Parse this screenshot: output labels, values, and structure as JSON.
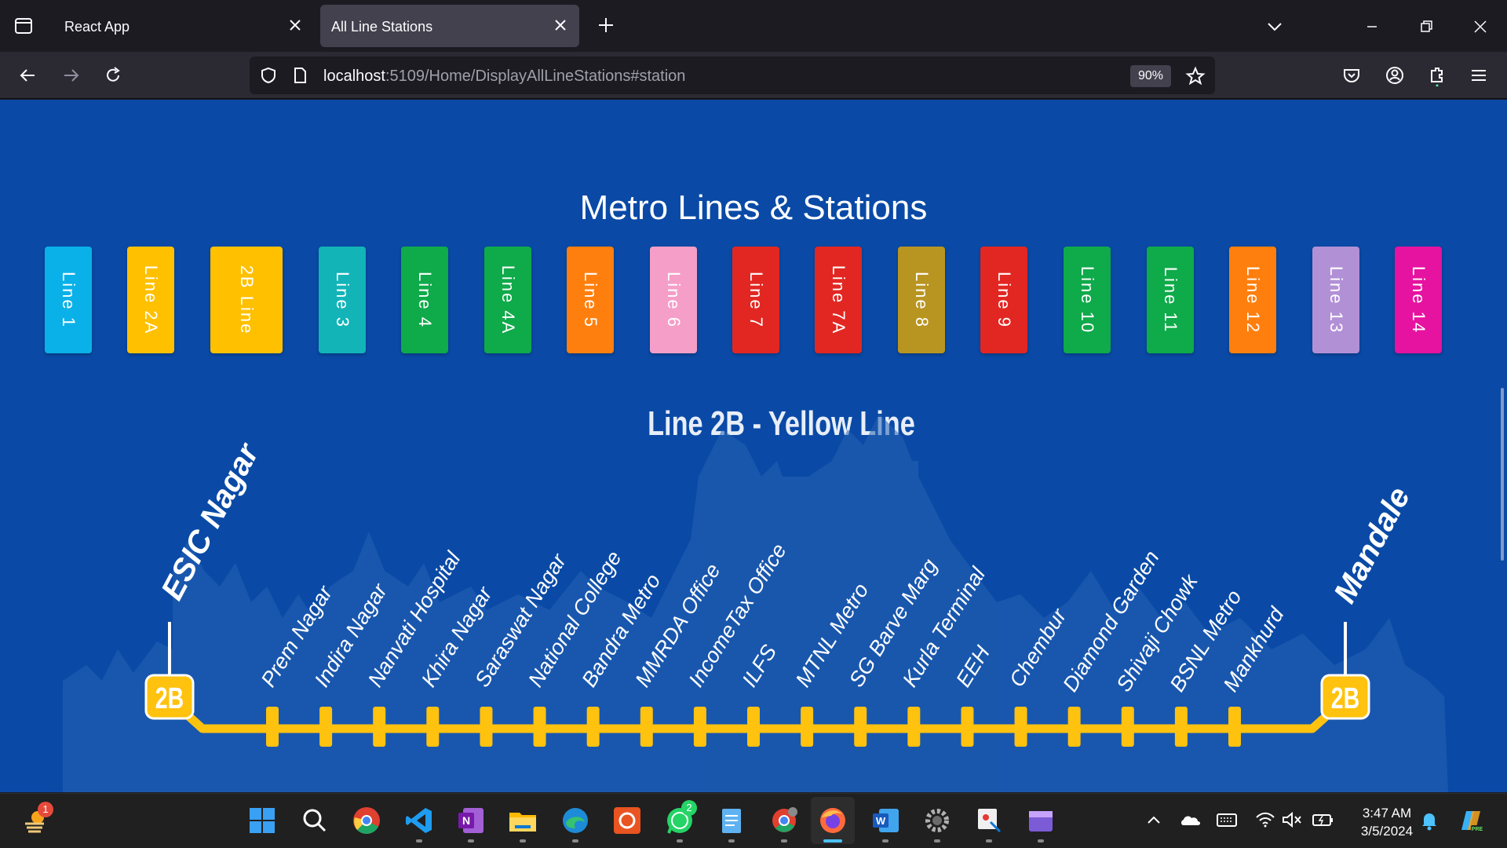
{
  "browser": {
    "tabs": [
      {
        "title": "React App",
        "active": false
      },
      {
        "title": "All Line Stations",
        "active": true
      }
    ],
    "url_host": "localhost",
    "url_rest": ":5109/Home/DisplayAllLineStations#station",
    "zoom": "90%"
  },
  "page": {
    "title": "Metro Lines & Stations",
    "line_buttons": [
      {
        "label": "Line 1",
        "color": "#0ab1e8"
      },
      {
        "label": "Line 2A",
        "color": "#ffc000"
      },
      {
        "label": "2B Line",
        "color": "#ffc000"
      },
      {
        "label": "Line 3",
        "color": "#12b4b8"
      },
      {
        "label": "Line 4",
        "color": "#0faa4a"
      },
      {
        "label": "Line 4A",
        "color": "#0faa4a"
      },
      {
        "label": "Line 5",
        "color": "#ff7f0e"
      },
      {
        "label": "Line 6",
        "color": "#f59ec8"
      },
      {
        "label": "Line 7",
        "color": "#e22722"
      },
      {
        "label": "Line 7A",
        "color": "#e22722"
      },
      {
        "label": "Line 8",
        "color": "#b89521"
      },
      {
        "label": "Line 9",
        "color": "#e22722"
      },
      {
        "label": "Line 10",
        "color": "#0faa4a"
      },
      {
        "label": "Line 11",
        "color": "#0faa4a"
      },
      {
        "label": "Line 12",
        "color": "#ff7f0e"
      },
      {
        "label": "Line 13",
        "color": "#b290d6"
      },
      {
        "label": "Line 14",
        "color": "#e612a0"
      }
    ],
    "line_heading": "Line 2B - Yellow Line",
    "line_color": "#ffc20e",
    "terminal_badge": "2B",
    "start_terminal": "ESIC Nagar",
    "end_terminal": "Mandale",
    "stations": [
      "Prem Nagar",
      "Indira Nagar",
      "Nanvati Hospital",
      "Khira Nagar",
      "Saraswat Nagar",
      "National College",
      "Bandra Metro",
      "MMRDA Office",
      "IncomeTax Office",
      "ILFS",
      "MTNL Metro",
      "SG Barve Marg",
      "Kurla Terminal",
      "EEH",
      "Chembur",
      "Diamond Garden",
      "Shivaji Chowk",
      "BSNL Metro",
      "Mankhurd"
    ]
  },
  "taskbar": {
    "time": "3:47 AM",
    "date": "3/5/2024",
    "notification_badge": "1",
    "whatsapp_badge": "2",
    "icons": [
      "weather-icon",
      "windows-start-icon",
      "search-icon",
      "chrome-icon",
      "vscode-icon",
      "onenote-icon",
      "file-explorer-icon",
      "edge-icon",
      "ubuntu-icon",
      "whatsapp-icon",
      "notepad-icon",
      "chrome-profile-icon",
      "firefox-icon",
      "word-icon",
      "settings-icon",
      "snipping-tool-icon",
      "clipchamp-icon"
    ]
  }
}
